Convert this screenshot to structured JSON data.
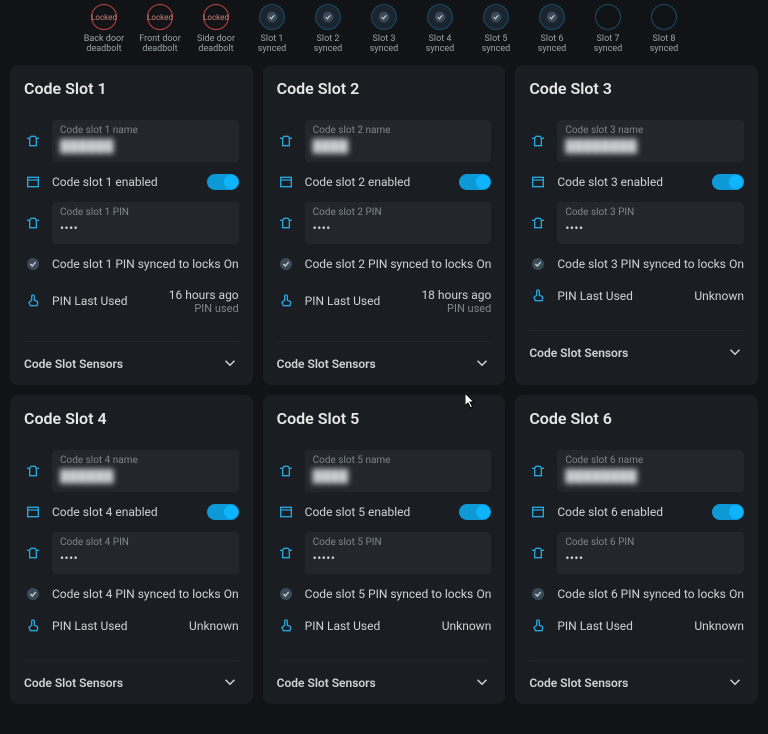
{
  "chips": [
    {
      "kind": "locked",
      "text": "Locked",
      "label": "Back door deadbolt"
    },
    {
      "kind": "locked",
      "text": "Locked",
      "label": "Front door deadbolt"
    },
    {
      "kind": "locked",
      "text": "Locked",
      "label": "Side door deadbolt"
    },
    {
      "kind": "synced",
      "label": "Slot 1 synced"
    },
    {
      "kind": "synced",
      "label": "Slot 2 synced"
    },
    {
      "kind": "synced",
      "label": "Slot 3 synced"
    },
    {
      "kind": "synced",
      "label": "Slot 4 synced"
    },
    {
      "kind": "synced",
      "label": "Slot 5 synced"
    },
    {
      "kind": "synced",
      "label": "Slot 6 synced"
    },
    {
      "kind": "empty",
      "label": "Slot 7 synced"
    },
    {
      "kind": "empty",
      "label": "Slot 8 synced"
    }
  ],
  "slots": [
    {
      "title": "Code Slot 1",
      "name_label": "Code slot 1 name",
      "name_value": "██████",
      "enabled_label": "Code slot 1 enabled",
      "pin_label": "Code slot 1 PIN",
      "pin_value": "••••",
      "sync_label": "Code slot 1 PIN synced to locks",
      "sync_value": "On",
      "lastused_label": "PIN Last Used",
      "lastused_time": "16 hours ago",
      "lastused_sub": "PIN used",
      "sensors": "Code Slot Sensors"
    },
    {
      "title": "Code Slot 2",
      "name_label": "Code slot 2 name",
      "name_value": "████",
      "enabled_label": "Code slot 2 enabled",
      "pin_label": "Code slot 2 PIN",
      "pin_value": "••••",
      "sync_label": "Code slot 2 PIN synced to locks",
      "sync_value": "On",
      "lastused_label": "PIN Last Used",
      "lastused_time": "18 hours ago",
      "lastused_sub": "PIN used",
      "sensors": "Code Slot Sensors"
    },
    {
      "title": "Code Slot 3",
      "name_label": "Code slot 3 name",
      "name_value": "████████",
      "enabled_label": "Code slot 3 enabled",
      "pin_label": "Code slot 3 PIN",
      "pin_value": "••••",
      "sync_label": "Code slot 3 PIN synced to locks",
      "sync_value": "On",
      "lastused_label": "PIN Last Used",
      "lastused_time": "Unknown",
      "lastused_sub": "",
      "sensors": "Code Slot Sensors"
    },
    {
      "title": "Code Slot 4",
      "name_label": "Code slot 4 name",
      "name_value": "██████",
      "enabled_label": "Code slot 4 enabled",
      "pin_label": "Code slot 4 PIN",
      "pin_value": "••••",
      "sync_label": "Code slot 4 PIN synced to locks",
      "sync_value": "On",
      "lastused_label": "PIN Last Used",
      "lastused_time": "Unknown",
      "lastused_sub": "",
      "sensors": "Code Slot Sensors"
    },
    {
      "title": "Code Slot 5",
      "name_label": "Code slot 5 name",
      "name_value": "████",
      "enabled_label": "Code slot 5 enabled",
      "pin_label": "Code slot 5 PIN",
      "pin_value": "•••••",
      "sync_label": "Code slot 5 PIN synced to locks",
      "sync_value": "On",
      "lastused_label": "PIN Last Used",
      "lastused_time": "Unknown",
      "lastused_sub": "",
      "sensors": "Code Slot Sensors"
    },
    {
      "title": "Code Slot 6",
      "name_label": "Code slot 6 name",
      "name_value": "████████",
      "enabled_label": "Code slot 6 enabled",
      "pin_label": "Code slot 6 PIN",
      "pin_value": "••••",
      "sync_label": "Code slot 6 PIN synced to locks",
      "sync_value": "On",
      "lastused_label": "PIN Last Used",
      "lastused_time": "Unknown",
      "lastused_sub": "",
      "sensors": "Code Slot Sensors"
    }
  ]
}
